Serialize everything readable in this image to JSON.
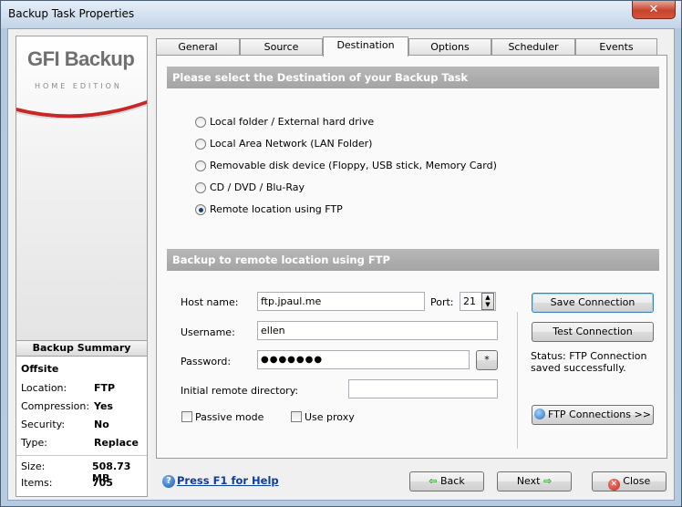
{
  "window": {
    "title": "Backup Task Properties",
    "close_glyph": "✕"
  },
  "logo": {
    "brand_gfi": "GFI",
    "brand_backup": "Backup",
    "edition": "HOME EDITION"
  },
  "summary": {
    "header": "Backup Summary",
    "title": "Offsite",
    "rows": [
      {
        "label": "Location:",
        "value": "FTP"
      },
      {
        "label": "Compression:",
        "value": "Yes"
      },
      {
        "label": "Security:",
        "value": "No"
      },
      {
        "label": "Type:",
        "value": "Replace"
      },
      {
        "label": "Size:",
        "value": "508.73 MB"
      },
      {
        "label": "Items:",
        "value": "705"
      }
    ]
  },
  "tabs": [
    {
      "label": "General"
    },
    {
      "label": "Source"
    },
    {
      "label": "Destination",
      "active": true
    },
    {
      "label": "Options"
    },
    {
      "label": "Scheduler"
    },
    {
      "label": "Events"
    }
  ],
  "destination": {
    "section_title": "Please select the Destination of your Backup Task",
    "options": [
      {
        "label": "Local folder / External hard drive",
        "checked": false
      },
      {
        "label": "Local Area Network (LAN Folder)",
        "checked": false
      },
      {
        "label": "Removable disk device (Floppy, USB stick, Memory Card)",
        "checked": false
      },
      {
        "label": "CD / DVD / Blu-Ray",
        "checked": false
      },
      {
        "label": "Remote location using FTP",
        "checked": true
      }
    ]
  },
  "ftp": {
    "section_title": "Backup to remote location using FTP",
    "host_label": "Host name:",
    "host_value": "ftp.jpaul.me",
    "port_label": "Port:",
    "port_value": "21",
    "username_label": "Username:",
    "username_value": "ellen",
    "password_label": "Password:",
    "password_value": "●●●●●●●",
    "password_reveal": "*",
    "remote_dir_label": "Initial remote directory:",
    "remote_dir_value": "",
    "passive_label": "Passive mode",
    "proxy_label": "Use proxy",
    "save_button": "Save Connection",
    "test_button": "Test Connection",
    "status_line1": "Status:  FTP Connection",
    "status_line2": "saved successfully.",
    "ftp_connections_button": "FTP Connections >>"
  },
  "footer": {
    "help_link": "Press F1 for Help",
    "back_button": "Back",
    "next_button": "Next",
    "close_button": "Close"
  }
}
